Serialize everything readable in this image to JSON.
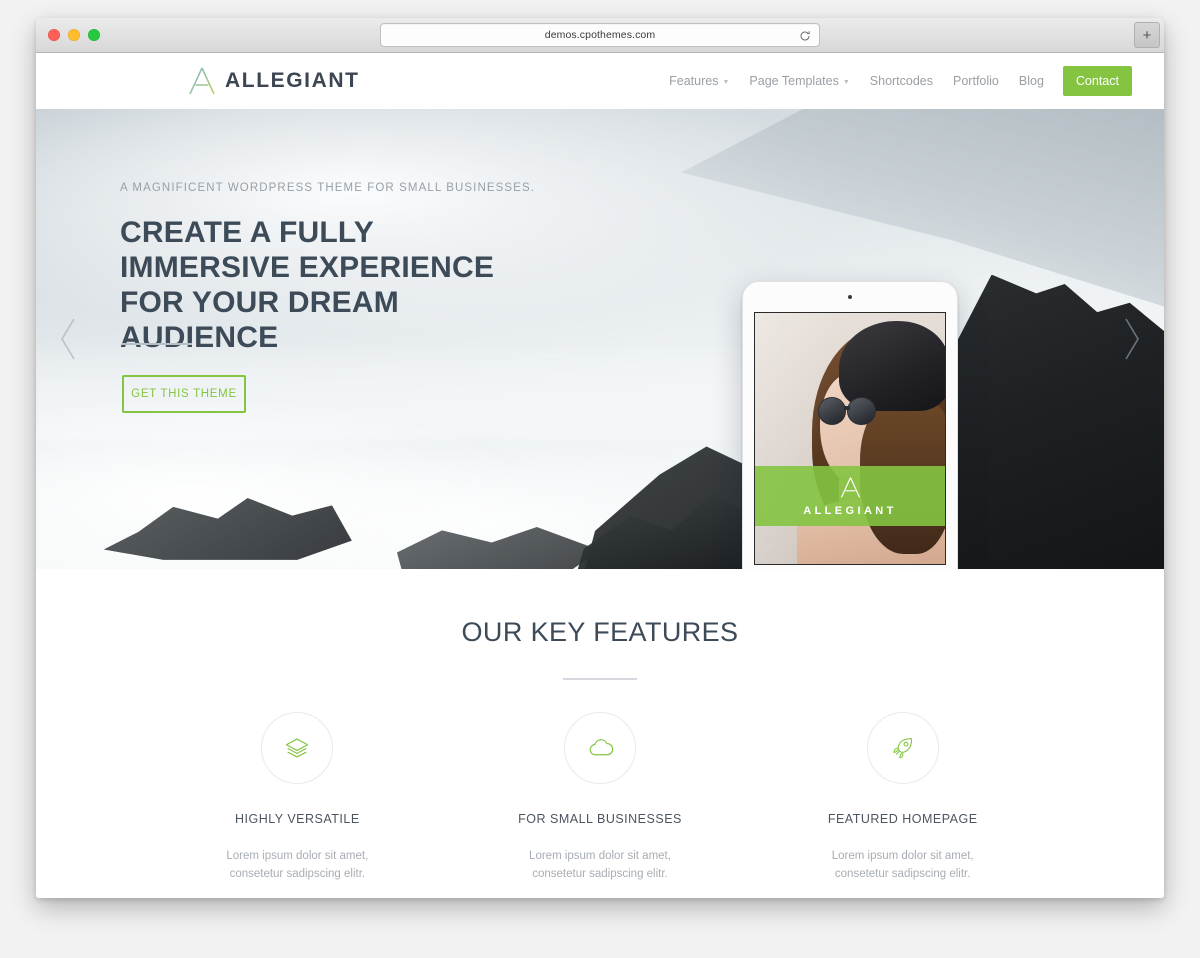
{
  "browser": {
    "url": "demos.cpothemes.com",
    "reload_icon": "reload-icon",
    "new_tab_label": "+",
    "traffic_lights": [
      "close",
      "minimize",
      "maximize"
    ]
  },
  "site": {
    "logo": {
      "text": "ALLEGIANT",
      "mark": "allegiant-a-mark"
    },
    "nav": {
      "items": [
        {
          "label": "Features",
          "has_dropdown": true
        },
        {
          "label": "Page Templates",
          "has_dropdown": true
        },
        {
          "label": "Shortcodes",
          "has_dropdown": false
        },
        {
          "label": "Portfolio",
          "has_dropdown": false
        },
        {
          "label": "Blog",
          "has_dropdown": false
        }
      ],
      "cta": {
        "label": "Contact",
        "color": "#84c441"
      }
    },
    "hero": {
      "subtitle": "A MAGNIFICENT WORDPRESS THEME FOR SMALL BUSINESSES.",
      "title": "CREATE A FULLY IMMERSIVE EXPERIENCE FOR YOUR DREAM AUDIENCE",
      "button": "GET THIS THEME",
      "prev_icon": "chevron-left-icon",
      "next_icon": "chevron-right-icon",
      "device": {
        "type": "tablet-mockup",
        "overlay_text": "ALLEGIANT",
        "overlay_color": "#84c441"
      }
    },
    "features": {
      "title": "OUR KEY FEATURES",
      "cards": [
        {
          "icon": "layers-icon",
          "title": "HIGHLY VERSATILE",
          "desc": "Lorem ipsum dolor sit amet, consetetur sadipscing elitr."
        },
        {
          "icon": "cloud-icon",
          "title": "FOR SMALL BUSINESSES",
          "desc": "Lorem ipsum dolor sit amet, consetetur sadipscing elitr."
        },
        {
          "icon": "rocket-icon",
          "title": "FEATURED HOMEPAGE",
          "desc": "Lorem ipsum dolor sit amet, consetetur sadipscing elitr."
        }
      ]
    }
  },
  "theme": {
    "accent": "#84c441",
    "heading": "#3d4a57",
    "muted": "#a7adb4"
  }
}
